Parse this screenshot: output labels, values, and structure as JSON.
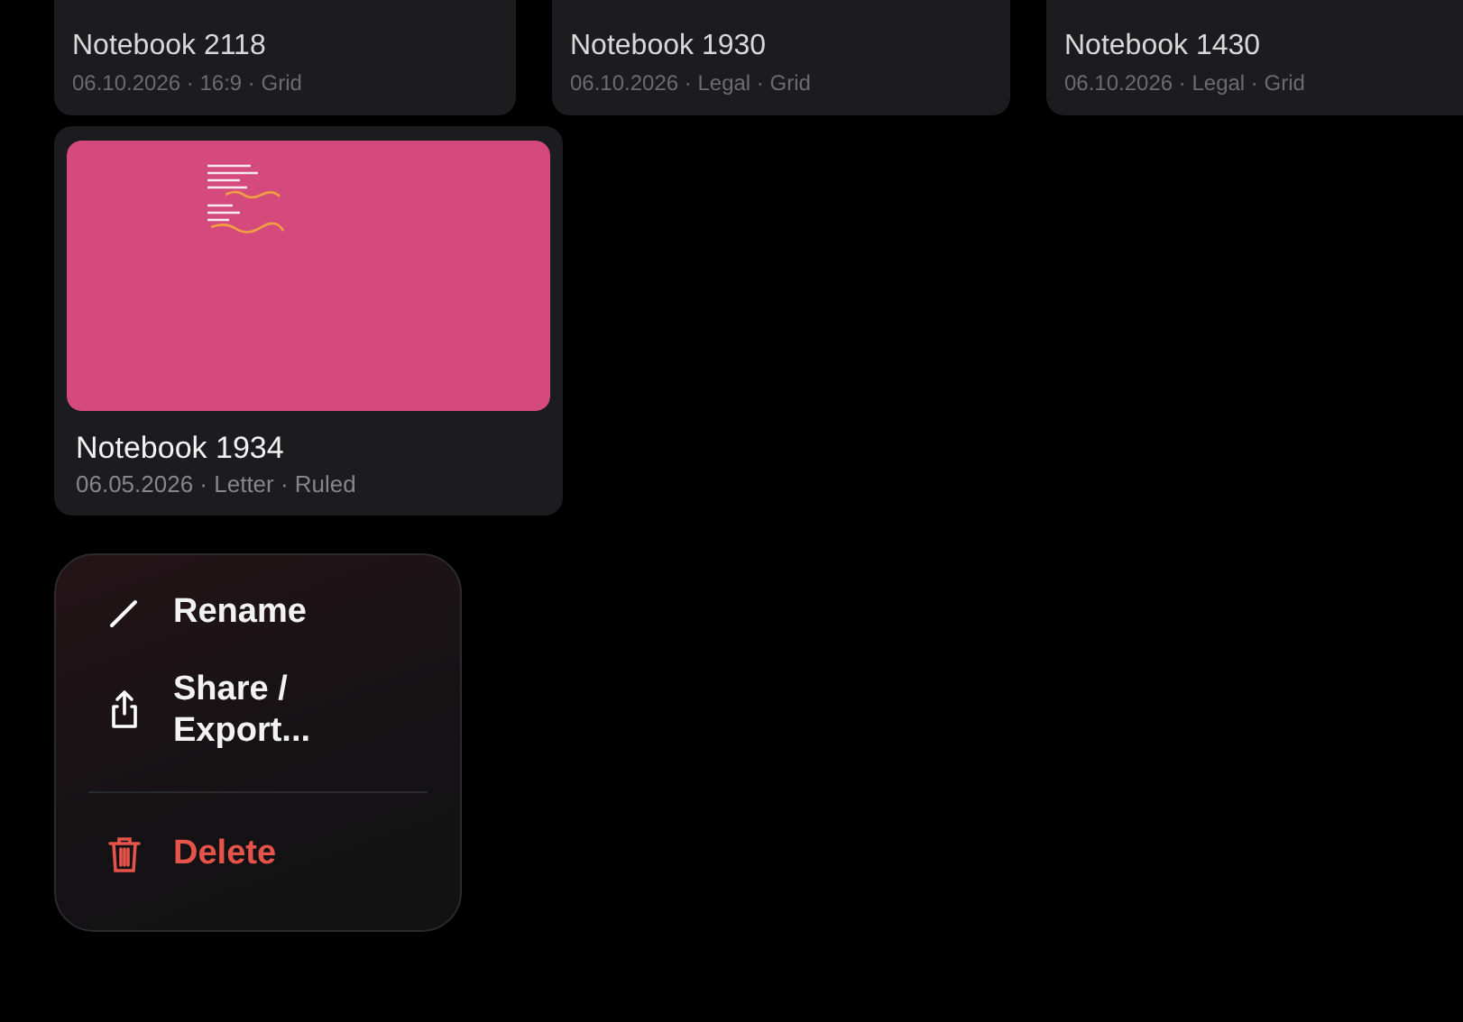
{
  "top_row": [
    {
      "title": "Notebook 2118",
      "meta": "06.10.2026 · 16:9 · Grid"
    },
    {
      "title": "Notebook 1930",
      "meta": "06.10.2026 · Legal · Grid"
    },
    {
      "title": "Notebook 1430",
      "meta": "06.10.2026 · Legal · Grid"
    }
  ],
  "notebook": {
    "title": "Notebook 1934",
    "meta": "06.05.2026 · Letter · Ruled"
  },
  "context_menu": [
    {
      "kind": "action",
      "label": "Rename"
    },
    {
      "kind": "action",
      "label": "Share /\nExport..."
    },
    {
      "kind": "destructive",
      "label": "Delete"
    }
  ]
}
